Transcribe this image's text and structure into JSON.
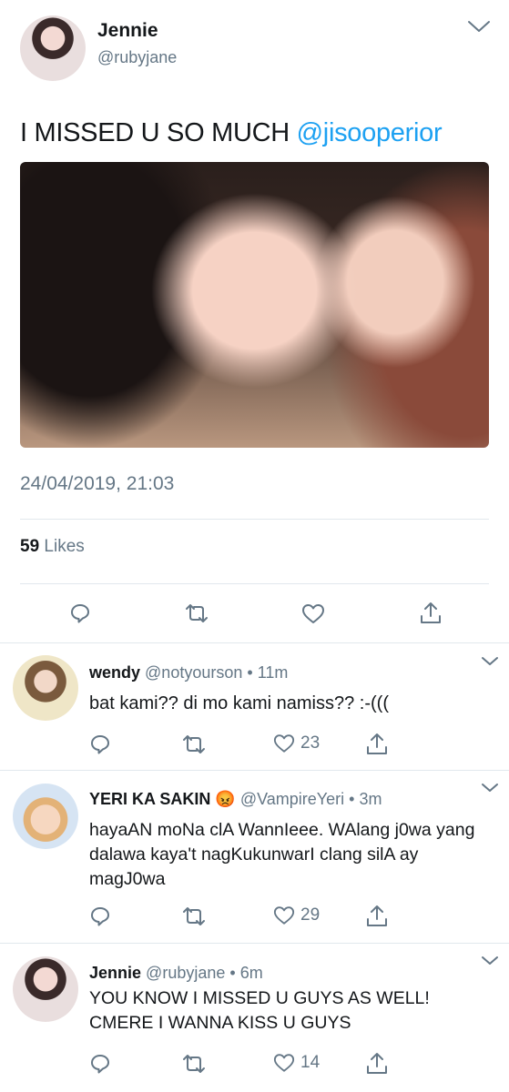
{
  "tweet": {
    "name": "Jennie",
    "handle": "@rubyjane",
    "text": "I MISSED U SO MUCH",
    "mention": "@jisooperior",
    "timestamp": "24/04/2019, 21:03",
    "likes_count": "59",
    "likes_label": "Likes"
  },
  "replies": [
    {
      "name": "wendy",
      "emoji": "",
      "handle": "@notyourson",
      "time": "• 11m",
      "text": "bat kami?? di mo kami namiss?? :-(((",
      "likes": "23"
    },
    {
      "name": "YERI KA SAKIN",
      "emoji": "😡",
      "handle": "@VampireYeri",
      "time": "• 3m",
      "text": "hayaAN moNa clA WannIeee. WAlang j0wa yang dalawa kaya't nagKukunwarI clang silA ay magJ0wa",
      "likes": "29"
    },
    {
      "name": "Jennie",
      "emoji": "",
      "handle": "@rubyjane",
      "time": "• 6m",
      "text": "YOU KNOW I MISSED U GUYS AS WELL! CMERE I WANNA KISS U GUYS",
      "likes": "14"
    }
  ],
  "icons": {
    "reply": "reply-icon",
    "retweet": "retweet-icon",
    "like": "heart-icon",
    "share": "share-icon",
    "more": "chevron-down-icon"
  },
  "colors": {
    "accent": "#1da1f2",
    "secondary_text": "#657786",
    "divider": "#e1e8ed"
  }
}
